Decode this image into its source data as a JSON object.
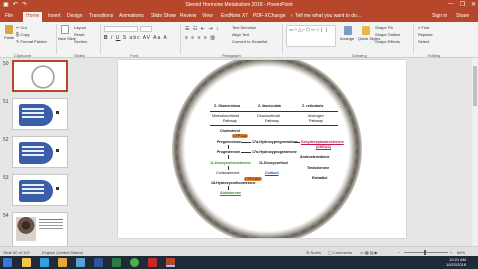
{
  "window": {
    "title": "Steroid Hormone Metabolism 2018 - PowerPoint",
    "minimize": "—",
    "restore": "❐",
    "close": "✕"
  },
  "tabs": [
    "File",
    "Home",
    "Insert",
    "Design",
    "Transitions",
    "Animations",
    "Slide Show",
    "Review",
    "View",
    "EndNote X7",
    "PDF-XChange"
  ],
  "active_tab": "Home",
  "tell_me": "Tell me what you want to do...",
  "sign_in": "Sign in",
  "share": "Share",
  "ribbon": {
    "clipboard": {
      "paste": "Paste",
      "cut": "Cut",
      "copy": "Copy",
      "format_painter": "Format Painter",
      "label": "Clipboard"
    },
    "slides": {
      "new_slide": "New Slide",
      "layout": "Layout",
      "reset": "Reset",
      "section": "Section",
      "label": "Slides"
    },
    "font": {
      "label": "Font"
    },
    "paragraph": {
      "text_direction": "Text Direction",
      "align_text": "Align Text",
      "smartart": "Convert to SmartArt",
      "label": "Paragraph"
    },
    "drawing": {
      "arrange": "Arrange",
      "quick_styles": "Quick Styles",
      "shape_fill": "Shape Fill",
      "shape_outline": "Shape Outline",
      "shape_effects": "Shape Effects",
      "label": "Drawing"
    },
    "editing": {
      "find": "Find",
      "replace": "Replace",
      "select": "Select",
      "label": "Editing"
    }
  },
  "thumbnails": [
    {
      "num": "50",
      "selected": true
    },
    {
      "num": "51",
      "selected": false
    },
    {
      "num": "52",
      "selected": false
    },
    {
      "num": "53",
      "selected": false
    },
    {
      "num": "54",
      "selected": false
    }
  ],
  "slide": {
    "col1_head": "Z. Glomerulosa",
    "col2_head": "Z. fasciculata",
    "col3_head": "Z. reticularis",
    "col1_sub1": "Mineralocorticoid",
    "col1_sub2": "Pathway",
    "col2_sub1": "Glucocorticoid",
    "col2_sub2": "Pathway",
    "col3_sub1": "Androgen",
    "col3_sub2": "Pathway",
    "cholesterol": "Cholesterol",
    "enzyme1": "CYP11A",
    "pregnenolone": "Pregnenolone",
    "oh_preg": "17α-Hydroxypregnenolone",
    "dhea": "Dehydroepiandrosterone",
    "dheas": "(DHEAS)",
    "progesterone": "Progesterone",
    "oh_prog": "17α-Hydroxyprogesterone",
    "androstenedione": "Androstenedione",
    "doc": "11-Deoxycorticosterone",
    "deoxycortisol": "11-Deoxycortisol",
    "testosterone": "Testosterone",
    "corticosterone": "Corticosterone",
    "cortisol": "Cortisol",
    "estradiol": "Estradiol",
    "oh_cort": "18-Hydroxycorticosterone",
    "enzyme2": "CYP11B2",
    "aldosterone": "Aldosterone"
  },
  "status": {
    "slide_of": "Slide 50 of 102",
    "lang": "English (United States)",
    "notes": "Notes",
    "comments": "Comments",
    "zoom": "86%"
  },
  "clock": {
    "time": "10:21 AM",
    "date": "10/22/2018"
  },
  "colors": {
    "accent": "#b7472a",
    "slide_orange": "#e8852c"
  }
}
